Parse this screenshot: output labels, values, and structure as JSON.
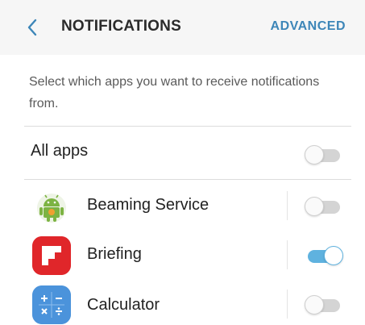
{
  "header": {
    "back_icon": "chevron-left-icon",
    "title": "NOTIFICATIONS",
    "action": "ADVANCED"
  },
  "description": "Select which apps you want to receive notifications from.",
  "all_apps": {
    "label": "All apps",
    "enabled": false
  },
  "apps": [
    {
      "label": "Beaming Service",
      "icon": "android-icon",
      "enabled": false
    },
    {
      "label": "Briefing",
      "icon": "flipboard-icon",
      "enabled": true
    },
    {
      "label": "Calculator",
      "icon": "calculator-icon",
      "enabled": false
    }
  ],
  "colors": {
    "accent": "#3d86b8",
    "toggle_on": "#5fb2df",
    "toggle_off": "#d4d4d4",
    "briefing_red": "#e0262a",
    "calculator_blue": "#4b93db",
    "android_green": "#7cb342"
  }
}
